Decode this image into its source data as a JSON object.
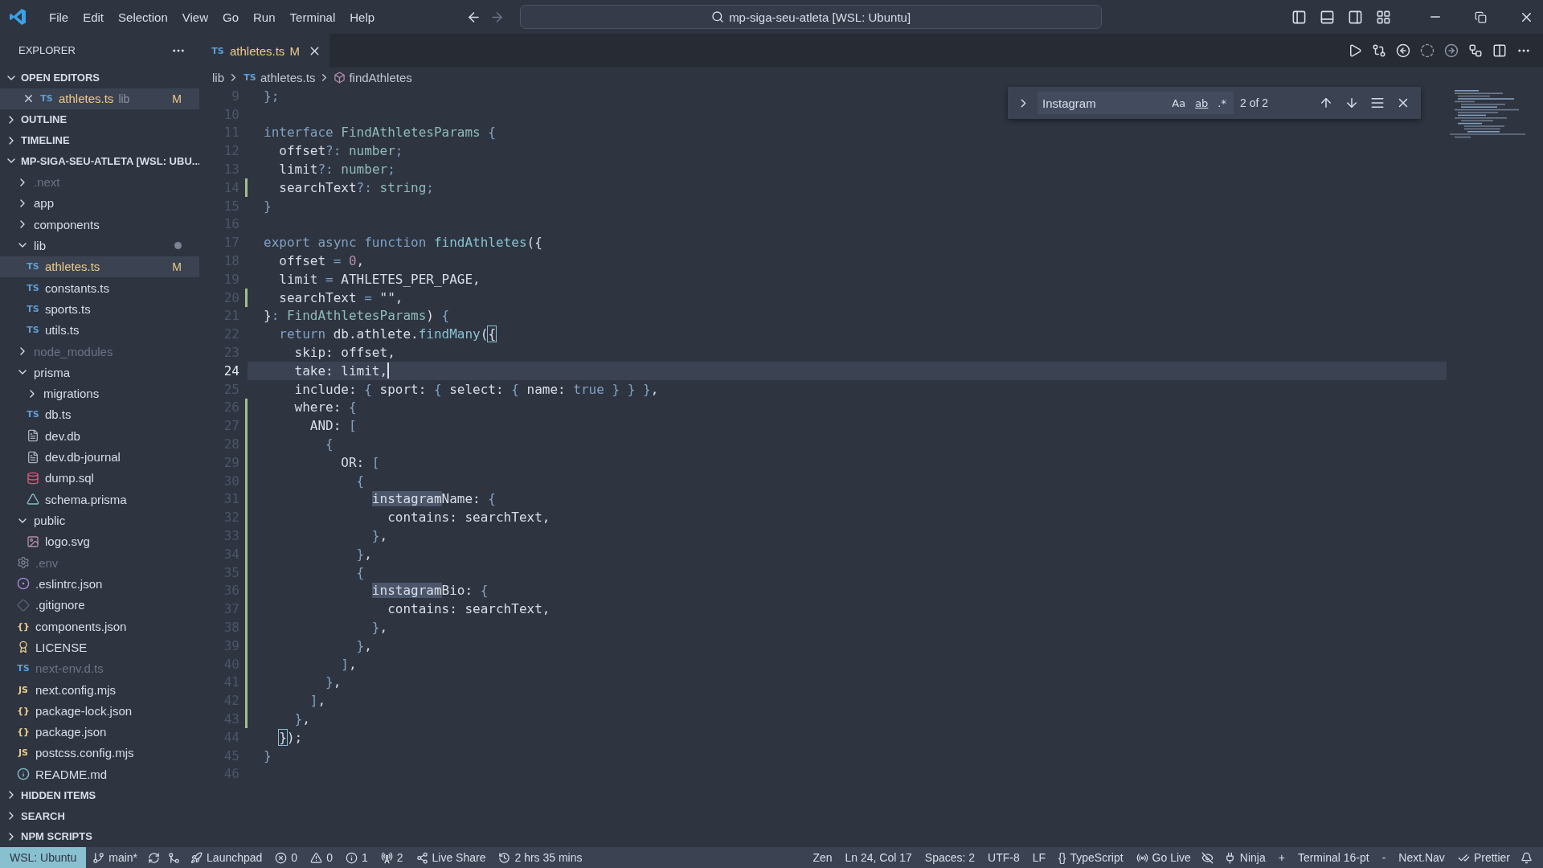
{
  "titlebar": {
    "menu": [
      "File",
      "Edit",
      "Selection",
      "View",
      "Go",
      "Run",
      "Terminal",
      "Help"
    ],
    "search": "mp-siga-seu-atleta [WSL: Ubuntu]"
  },
  "explorer": {
    "title": "EXPLORER",
    "sections": [
      {
        "kind": "editors",
        "title": "OPEN EDITORS",
        "expanded": true,
        "editors": [
          {
            "kind": "ts",
            "name": "athletes.ts",
            "icon_text": "TS",
            "folder": "lib",
            "status": "M",
            "selected": true
          }
        ]
      },
      {
        "title": "OUTLINE",
        "expanded": false
      },
      {
        "title": "TIMELINE",
        "expanded": false
      },
      {
        "kind": "tree",
        "title": "MP-SIGA-SEU-ATLETA [WSL: UBU...",
        "expanded": true,
        "items": [
          {
            "kind": "folder",
            "name": ".next",
            "expanded": false,
            "ignored": true,
            "has_changes": false,
            "selected": false
          },
          {
            "kind": "folder",
            "name": "app",
            "expanded": false,
            "ignored": false,
            "has_changes": false,
            "selected": false
          },
          {
            "kind": "folder",
            "name": "components",
            "expanded": false,
            "ignored": false,
            "has_changes": false,
            "selected": false
          },
          {
            "kind": "folder",
            "name": "lib",
            "expanded": true,
            "ignored": false,
            "has_changes": true,
            "selected": false,
            "children": [
              {
                "kind": "ts",
                "name": "athletes.ts",
                "icon_text": "TS",
                "status": "M",
                "ignored": false,
                "selected": true
              },
              {
                "kind": "ts",
                "name": "constants.ts",
                "icon_text": "TS",
                "ignored": false,
                "selected": false
              },
              {
                "kind": "ts",
                "name": "sports.ts",
                "icon_text": "TS",
                "ignored": false,
                "selected": false
              },
              {
                "kind": "ts",
                "name": "utils.ts",
                "icon_text": "TS",
                "ignored": false,
                "selected": false
              }
            ]
          },
          {
            "kind": "folder",
            "name": "node_modules",
            "expanded": false,
            "ignored": true,
            "has_changes": false,
            "selected": false
          },
          {
            "kind": "folder",
            "name": "prisma",
            "expanded": true,
            "ignored": false,
            "has_changes": false,
            "selected": false,
            "children": [
              {
                "kind": "folder",
                "name": "migrations",
                "expanded": false,
                "ignored": false,
                "has_changes": false,
                "selected": false
              },
              {
                "kind": "ts",
                "name": "db.ts",
                "icon_text": "TS",
                "ignored": false,
                "selected": false
              },
              {
                "kind": "text",
                "name": "dev.db",
                "ignored": false,
                "selected": false
              },
              {
                "kind": "text",
                "name": "dev.db-journal",
                "ignored": false,
                "selected": false
              },
              {
                "kind": "database",
                "name": "dump.sql",
                "ignored": false,
                "selected": false
              },
              {
                "kind": "prisma",
                "name": "schema.prisma",
                "ignored": false,
                "selected": false
              }
            ]
          },
          {
            "kind": "folder",
            "name": "public",
            "expanded": true,
            "ignored": false,
            "has_changes": false,
            "selected": false,
            "children": [
              {
                "kind": "image",
                "name": "logo.svg",
                "ignored": false,
                "selected": false
              }
            ]
          },
          {
            "kind": "gear",
            "name": ".env",
            "ignored": true,
            "selected": false
          },
          {
            "kind": "eslint",
            "name": ".eslintrc.json",
            "ignored": false,
            "selected": false
          },
          {
            "kind": "git",
            "name": ".gitignore",
            "ignored": false,
            "selected": false
          },
          {
            "kind": "json",
            "name": "components.json",
            "icon_text": "{}",
            "ignored": false,
            "selected": false
          },
          {
            "kind": "license",
            "name": "LICENSE",
            "ignored": false,
            "selected": false
          },
          {
            "kind": "ts",
            "name": "next-env.d.ts",
            "icon_text": "TS",
            "ignored": true,
            "selected": false
          },
          {
            "kind": "js",
            "name": "next.config.mjs",
            "icon_text": "JS",
            "ignored": false,
            "selected": false
          },
          {
            "kind": "json",
            "name": "package-lock.json",
            "icon_text": "{}",
            "ignored": false,
            "selected": false
          },
          {
            "kind": "json",
            "name": "package.json",
            "icon_text": "{}",
            "ignored": false,
            "selected": false
          },
          {
            "kind": "js",
            "name": "postcss.config.mjs",
            "icon_text": "JS",
            "ignored": false,
            "selected": false
          },
          {
            "kind": "info",
            "name": "README.md",
            "ignored": false,
            "selected": false
          }
        ]
      },
      {
        "title": "HIDDEN ITEMS",
        "expanded": false
      },
      {
        "title": "SEARCH",
        "expanded": false
      },
      {
        "title": "NPM SCRIPTS",
        "expanded": false
      }
    ]
  },
  "tabs": [
    {
      "label": "athletes.ts",
      "icon_text": "TS",
      "status": "M",
      "selected": true
    }
  ],
  "breadcrumb": [
    {
      "kind": "folder",
      "label": "lib"
    },
    {
      "kind": "ts",
      "label": "athletes.ts",
      "icon_text": "TS"
    },
    {
      "kind": "symbol",
      "label": "findAthletes"
    }
  ],
  "find": {
    "value": "Instagram",
    "options": [
      {
        "label": "Aa",
        "on": false
      },
      {
        "label": "ab",
        "on": false
      },
      {
        "label": ".*",
        "on": false
      }
    ],
    "count": "2 of 2"
  },
  "code": [
    {
      "number": "9",
      "changed": false,
      "current": false,
      "tokens": [
        {
          "kind": "p",
          "text": "};"
        }
      ]
    },
    {
      "number": "10",
      "changed": false,
      "current": false
    },
    {
      "number": "11",
      "changed": false,
      "current": false,
      "tokens": [
        {
          "kind": "kw",
          "text": "interface "
        },
        {
          "kind": "ty",
          "text": "FindAthletesParams "
        },
        {
          "kind": "p",
          "text": "{"
        }
      ]
    },
    {
      "number": "12",
      "changed": false,
      "current": false,
      "tokens": [
        {
          "kind": "v",
          "text": "  offset"
        },
        {
          "kind": "p",
          "text": "?: "
        },
        {
          "kind": "ty",
          "text": "number"
        },
        {
          "kind": "p",
          "text": ";"
        }
      ]
    },
    {
      "number": "13",
      "changed": false,
      "current": false,
      "tokens": [
        {
          "kind": "v",
          "text": "  limit"
        },
        {
          "kind": "p",
          "text": "?: "
        },
        {
          "kind": "ty",
          "text": "number"
        },
        {
          "kind": "p",
          "text": ";"
        }
      ]
    },
    {
      "number": "14",
      "changed": true,
      "current": false,
      "tokens": [
        {
          "kind": "v",
          "text": "  searchText"
        },
        {
          "kind": "p",
          "text": "?: "
        },
        {
          "kind": "ty",
          "text": "string"
        },
        {
          "kind": "p",
          "text": ";"
        }
      ]
    },
    {
      "number": "15",
      "changed": false,
      "current": false,
      "tokens": [
        {
          "kind": "p",
          "text": "}"
        }
      ]
    },
    {
      "number": "16",
      "changed": false,
      "current": false
    },
    {
      "number": "17",
      "changed": false,
      "current": false,
      "tokens": [
        {
          "kind": "kw",
          "text": "export async function "
        },
        {
          "kind": "fn",
          "text": "findAthletes"
        },
        {
          "kind": "v",
          "text": "({"
        }
      ]
    },
    {
      "number": "18",
      "changed": false,
      "current": false,
      "tokens": [
        {
          "kind": "v",
          "text": "  offset "
        },
        {
          "kind": "p",
          "text": "= "
        },
        {
          "kind": "num",
          "text": "0"
        },
        {
          "kind": "v",
          "text": ","
        }
      ]
    },
    {
      "number": "19",
      "changed": false,
      "current": false,
      "tokens": [
        {
          "kind": "v",
          "text": "  limit "
        },
        {
          "kind": "p",
          "text": "= "
        },
        {
          "kind": "v",
          "text": "ATHLETES_PER_PAGE,"
        }
      ]
    },
    {
      "number": "20",
      "changed": true,
      "current": false,
      "tokens": [
        {
          "kind": "v",
          "text": "  searchText "
        },
        {
          "kind": "p",
          "text": "= "
        },
        {
          "kind": "v",
          "text": "\"\","
        }
      ]
    },
    {
      "number": "21",
      "changed": false,
      "current": false,
      "tokens": [
        {
          "kind": "v",
          "text": "}"
        },
        {
          "kind": "p",
          "text": ": "
        },
        {
          "kind": "ty",
          "text": "FindAthletesParams"
        },
        {
          "kind": "v",
          "text": ") "
        },
        {
          "kind": "p",
          "text": "{"
        }
      ]
    },
    {
      "number": "22",
      "changed": false,
      "current": false,
      "tokens": [
        {
          "kind": "kw",
          "text": "  return "
        },
        {
          "kind": "v",
          "text": "db.athlete."
        },
        {
          "kind": "fn",
          "text": "findMany"
        },
        {
          "kind": "v",
          "text": "("
        },
        {
          "kind": "bm",
          "text": "{"
        }
      ]
    },
    {
      "number": "23",
      "changed": false,
      "current": false,
      "tokens": [
        {
          "kind": "v",
          "text": "    skip: offset,"
        }
      ]
    },
    {
      "number": "24",
      "changed": false,
      "current": true,
      "tokens": [
        {
          "kind": "v",
          "text": "    take: limit,"
        }
      ]
    },
    {
      "number": "25",
      "changed": false,
      "current": false,
      "tokens": [
        {
          "kind": "v",
          "text": "    include: "
        },
        {
          "kind": "p",
          "text": "{ "
        },
        {
          "kind": "v",
          "text": "sport: "
        },
        {
          "kind": "p",
          "text": "{ "
        },
        {
          "kind": "v",
          "text": "select: "
        },
        {
          "kind": "p",
          "text": "{ "
        },
        {
          "kind": "v",
          "text": "name: "
        },
        {
          "kind": "kw",
          "text": "true "
        },
        {
          "kind": "p",
          "text": "} } }"
        },
        {
          "kind": "v",
          "text": ","
        }
      ]
    },
    {
      "number": "26",
      "changed": true,
      "current": false,
      "tokens": [
        {
          "kind": "v",
          "text": "    where: "
        },
        {
          "kind": "p",
          "text": "{"
        }
      ]
    },
    {
      "number": "27",
      "changed": true,
      "current": false,
      "tokens": [
        {
          "kind": "v",
          "text": "      AND: "
        },
        {
          "kind": "p",
          "text": "["
        }
      ]
    },
    {
      "number": "28",
      "changed": true,
      "current": false,
      "tokens": [
        {
          "kind": "p",
          "text": "        {"
        }
      ]
    },
    {
      "number": "29",
      "changed": true,
      "current": false,
      "tokens": [
        {
          "kind": "v",
          "text": "          OR: "
        },
        {
          "kind": "p",
          "text": "["
        }
      ]
    },
    {
      "number": "30",
      "changed": true,
      "current": false,
      "tokens": [
        {
          "kind": "p",
          "text": "            {"
        }
      ]
    },
    {
      "number": "31",
      "changed": true,
      "current": false,
      "tokens": [
        {
          "kind": "m",
          "text": "              instagram"
        },
        {
          "kind": "v",
          "text": "Name: "
        },
        {
          "kind": "p",
          "text": "{"
        }
      ]
    },
    {
      "number": "32",
      "changed": true,
      "current": false,
      "tokens": [
        {
          "kind": "v",
          "text": "                contains: searchText,"
        }
      ]
    },
    {
      "number": "33",
      "changed": true,
      "current": false,
      "tokens": [
        {
          "kind": "p",
          "text": "              }"
        },
        {
          "kind": "v",
          "text": ","
        }
      ]
    },
    {
      "number": "34",
      "changed": true,
      "current": false,
      "tokens": [
        {
          "kind": "p",
          "text": "            }"
        },
        {
          "kind": "v",
          "text": ","
        }
      ]
    },
    {
      "number": "35",
      "changed": true,
      "current": false,
      "tokens": [
        {
          "kind": "p",
          "text": "            {"
        }
      ]
    },
    {
      "number": "36",
      "changed": true,
      "current": false,
      "tokens": [
        {
          "kind": "m",
          "text": "              instagram"
        },
        {
          "kind": "v",
          "text": "Bio: "
        },
        {
          "kind": "p",
          "text": "{"
        }
      ]
    },
    {
      "number": "37",
      "changed": true,
      "current": false,
      "tokens": [
        {
          "kind": "v",
          "text": "                contains: searchText,"
        }
      ]
    },
    {
      "number": "38",
      "changed": true,
      "current": false,
      "tokens": [
        {
          "kind": "p",
          "text": "              }"
        },
        {
          "kind": "v",
          "text": ","
        }
      ]
    },
    {
      "number": "39",
      "changed": true,
      "current": false,
      "tokens": [
        {
          "kind": "p",
          "text": "            }"
        },
        {
          "kind": "v",
          "text": ","
        }
      ]
    },
    {
      "number": "40",
      "changed": true,
      "current": false,
      "tokens": [
        {
          "kind": "p",
          "text": "          ]"
        },
        {
          "kind": "v",
          "text": ","
        }
      ]
    },
    {
      "number": "41",
      "changed": true,
      "current": false,
      "tokens": [
        {
          "kind": "p",
          "text": "        }"
        },
        {
          "kind": "v",
          "text": ","
        }
      ]
    },
    {
      "number": "42",
      "changed": true,
      "current": false,
      "tokens": [
        {
          "kind": "p",
          "text": "      ]"
        },
        {
          "kind": "v",
          "text": ","
        }
      ]
    },
    {
      "number": "43",
      "changed": true,
      "current": false,
      "tokens": [
        {
          "kind": "p",
          "text": "    }"
        },
        {
          "kind": "v",
          "text": ","
        }
      ]
    },
    {
      "number": "44",
      "changed": false,
      "current": false,
      "tokens": [
        {
          "kind": "bm",
          "text": "  }"
        },
        {
          "kind": "v",
          "text": ");"
        }
      ]
    },
    {
      "number": "45",
      "changed": false,
      "current": false,
      "tokens": [
        {
          "kind": "p",
          "text": "}"
        }
      ]
    },
    {
      "number": "46",
      "changed": false,
      "current": false
    }
  ],
  "status_bar": {
    "remote": "WSL: Ubuntu",
    "left": [
      {
        "kind": "branch",
        "text": "main*"
      },
      {
        "kind": "sync"
      },
      {
        "kind": "graph"
      },
      {
        "kind": "rocket",
        "text": "Launchpad"
      },
      {
        "kind": "error",
        "text": "0"
      },
      {
        "kind": "warning",
        "text": "0"
      },
      {
        "kind": "info",
        "text": "1"
      },
      {
        "kind": "broadcast",
        "text": "2"
      },
      {
        "kind": "share",
        "text": "Live Share"
      },
      {
        "kind": "history",
        "text": "2 hrs 35 mins"
      }
    ],
    "right": [
      {
        "kind": "plain",
        "text": "Zen"
      },
      {
        "kind": "plain",
        "text": "Ln 24, Col 17"
      },
      {
        "kind": "plain",
        "text": "Spaces: 2"
      },
      {
        "kind": "plain",
        "text": "UTF-8"
      },
      {
        "kind": "plain",
        "text": "LF"
      },
      {
        "kind": "language",
        "icon_text": "{}",
        "text": "TypeScript"
      },
      {
        "kind": "radio",
        "text": "Go Live"
      },
      {
        "kind": "eye-off"
      },
      {
        "kind": "plug",
        "text": "Ninja"
      },
      {
        "kind": "plain",
        "text": "+"
      },
      {
        "kind": "plain",
        "text": "Terminal 16-pt"
      },
      {
        "kind": "plain",
        "text": "-"
      },
      {
        "kind": "plain",
        "text": "Next.Nav"
      },
      {
        "kind": "checks",
        "text": "Prettier"
      },
      {
        "kind": "bell"
      }
    ]
  }
}
